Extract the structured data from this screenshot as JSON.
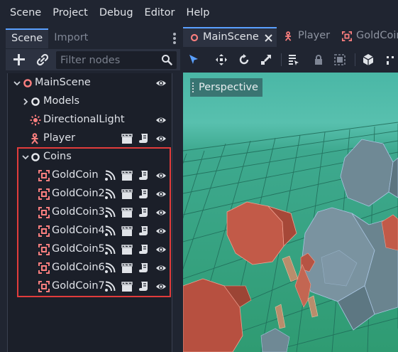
{
  "menu": [
    "Scene",
    "Project",
    "Debug",
    "Editor",
    "Help"
  ],
  "dock": {
    "tabs": [
      "Scene",
      "Import"
    ],
    "filter_placeholder": "Filter nodes"
  },
  "tree": {
    "main": "MainScene",
    "models": "Models",
    "light": "DirectionalLight",
    "player": "Player",
    "coins": "Coins",
    "gold_coins": [
      "GoldCoin",
      "GoldCoin2",
      "GoldCoin3",
      "GoldCoin4",
      "GoldCoin5",
      "GoldCoin6",
      "GoldCoin7"
    ]
  },
  "editor_tabs": [
    "MainScene",
    "Player",
    "GoldCoin"
  ],
  "viewport": {
    "label": "Perspective"
  },
  "colors": {
    "accent": "#5aa0ff",
    "node3d_icon": "#fc7f7f",
    "highlight_box": "#e23c3c",
    "sky": "#49b9a8",
    "ground": "#2a8f6c"
  }
}
